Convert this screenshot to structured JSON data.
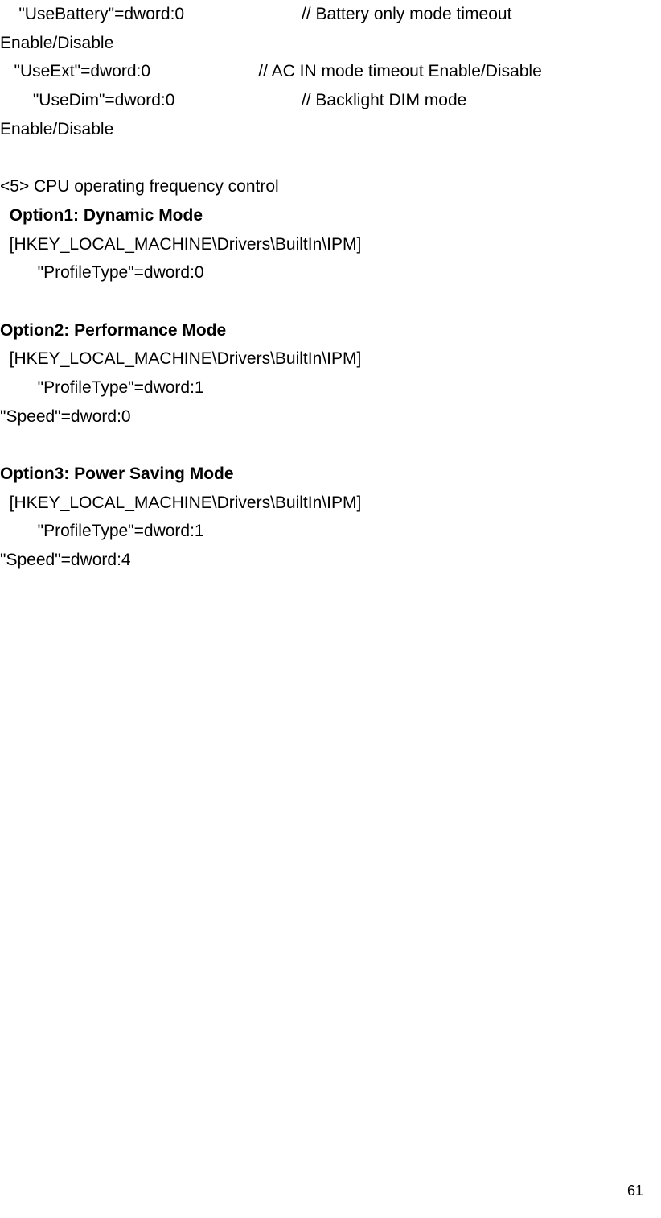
{
  "lines": {
    "l1": "    \"UseBattery\"=dword:0                         // Battery only mode timeout",
    "l2": "Enable/Disable",
    "l3": "   \"UseExt\"=dword:0                       // AC IN mode timeout Enable/Disable",
    "l4": "       \"UseDim\"=dword:0                           // Backlight DIM mode",
    "l5": "Enable/Disable",
    "blank1": " ",
    "l6a": "<",
    "l6b": "5",
    "l6c": "> CPU operating frequency control",
    "l7": "  Option1: Dynamic Mode",
    "l8": "  [HKEY_LOCAL_MACHINE\\Drivers\\BuiltIn\\IPM]",
    "l9": "        \"ProfileType\"=dword:0",
    "blank2": " ",
    "l10": "Option2: Performance Mode",
    "l11": "  [HKEY_LOCAL_MACHINE\\Drivers\\BuiltIn\\IPM]",
    "l12": "        \"ProfileType\"=dword:1",
    "l13": "\"Speed\"=dword:0",
    "blank3": " ",
    "l14": "Option3: Power Saving Mode",
    "l15": "  [HKEY_LOCAL_MACHINE\\Drivers\\BuiltIn\\IPM]",
    "l16": "        \"ProfileType\"=dword:1",
    "l17": "\"Speed\"=dword:4"
  },
  "page_number": "61"
}
